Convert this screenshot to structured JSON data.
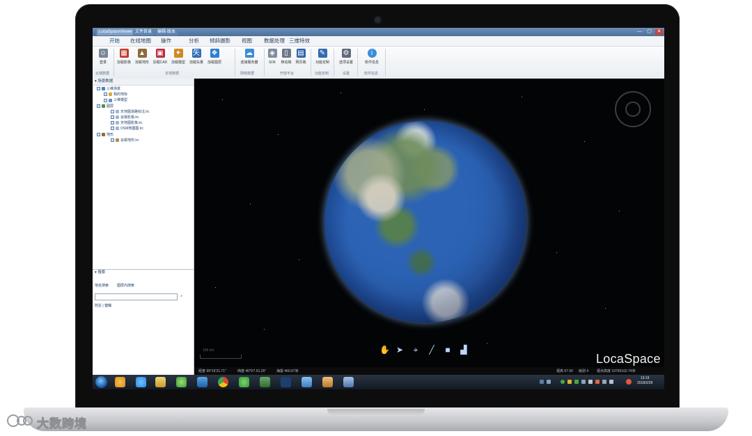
{
  "window": {
    "title": "LocaSpaceViewer",
    "tabs": [
      "LocaSpaceViewer",
      "文件目录",
      "编辑-版本"
    ],
    "controls": [
      "—",
      "▢",
      "✕"
    ]
  },
  "menu": [
    "开始",
    "在线地图",
    "操作",
    "分析",
    "倾斜摄影",
    "视图",
    "数据处理",
    "三维特效"
  ],
  "ribbon": {
    "buttons": [
      {
        "label": "登录",
        "icon": "user-icon",
        "color": "#7a8799"
      },
      {
        "label": "加载影像",
        "icon": "image-layer-icon",
        "color": "#c0392b"
      },
      {
        "label": "加载地形",
        "icon": "terrain-icon",
        "color": "#8e6b3a"
      },
      {
        "label": "加载CAD",
        "icon": "cad-icon",
        "color": "#c0283a"
      },
      {
        "label": "加载模型",
        "icon": "model-icon",
        "color": "#d08a24"
      },
      {
        "label": "加载矢量",
        "icon": "vector-icon",
        "color": "#2f6db3"
      },
      {
        "label": "加载图层",
        "icon": "layer-icon",
        "color": "#2f7fd0"
      },
      {
        "label": "连接服务器",
        "icon": "server-icon",
        "color": "#3a8fd8"
      },
      {
        "label": "SDK",
        "icon": "sdk-icon",
        "color": "#7f8c9c"
      },
      {
        "label": "移动端",
        "icon": "mobile-icon",
        "color": "#6a7888"
      },
      {
        "label": "网页端",
        "icon": "web-icon",
        "color": "#2d65a8"
      },
      {
        "label": "功能定制",
        "icon": "pen-icon",
        "color": "#2f6db3"
      },
      {
        "label": "选项设置",
        "icon": "gear-icon",
        "color": "#5f6b78"
      },
      {
        "label": "软件信息",
        "icon": "info-icon",
        "color": "#3a8fd8"
      }
    ],
    "groups": [
      "云端数据",
      "本地数据",
      "网络数据",
      "开放平台",
      "功能定制",
      "设置",
      "软件信息"
    ]
  },
  "left_panel": {
    "header": "场景数据",
    "tree": [
      {
        "label": "三维场景",
        "level": 0
      },
      {
        "label": "我的地标",
        "level": 1
      },
      {
        "label": "三维模型",
        "level": 1
      },
      {
        "label": "图层",
        "level": 0
      },
      {
        "label": "天地图道路标注.lrc",
        "level": 2
      },
      {
        "label": "谷歌影像.lrc",
        "level": 2
      },
      {
        "label": "天地图影像.lrc",
        "level": 2
      },
      {
        "label": "OSM地图图.lrc",
        "level": 2
      },
      {
        "label": "地形",
        "level": 0
      },
      {
        "label": "谷歌地形.lrc",
        "level": 2
      }
    ],
    "search": {
      "header": "搜索",
      "tabs": [
        "地名搜索",
        "图层内搜索"
      ],
      "input_value": "",
      "mode": "附近 | 模糊"
    }
  },
  "viewer": {
    "logo": "LocaSpace",
    "scale_label": "100 km",
    "tools": [
      "hand-icon",
      "pointer-icon",
      "placemark-icon",
      "line-icon",
      "polygon-icon",
      "chart-icon"
    ],
    "status": {
      "lon": "经度 99°16'21.71\"",
      "lat": "纬度 40°9'7.51.25\"",
      "alt": "海拔 460.67米",
      "view_alt": "视高 67.50",
      "level": "级别 4",
      "camera": "视点高度 19755162.74米"
    }
  },
  "taskbar": {
    "clock_time": "13:19",
    "clock_date": "2018/2/28",
    "apps": [
      {
        "icon": "windows-start-icon",
        "color": "#1e5fb0"
      },
      {
        "icon": "app-launcher-icon",
        "color": "#e08a1c"
      },
      {
        "icon": "ie-browser-icon",
        "color": "#2b8be0"
      },
      {
        "icon": "explorer-folder-icon",
        "color": "#d6b24a"
      },
      {
        "icon": "360-security-icon",
        "color": "#4fb540"
      },
      {
        "icon": "locaspace-app-icon",
        "color": "#2f7fd0"
      },
      {
        "icon": "chrome-icon",
        "color": "#d8482f"
      },
      {
        "icon": "wechat-icon",
        "color": "#3fae3b"
      },
      {
        "icon": "map-app-icon",
        "color": "#3a7a3a"
      },
      {
        "icon": "photoshop-icon",
        "color": "#1c3f6e"
      },
      {
        "icon": "image-viewer-icon",
        "color": "#4a90d0"
      },
      {
        "icon": "paint-icon",
        "color": "#c58b2a"
      },
      {
        "icon": "settings-app-icon",
        "color": "#5a7fb0"
      }
    ]
  },
  "watermark": {
    "text": "大数跨境"
  }
}
